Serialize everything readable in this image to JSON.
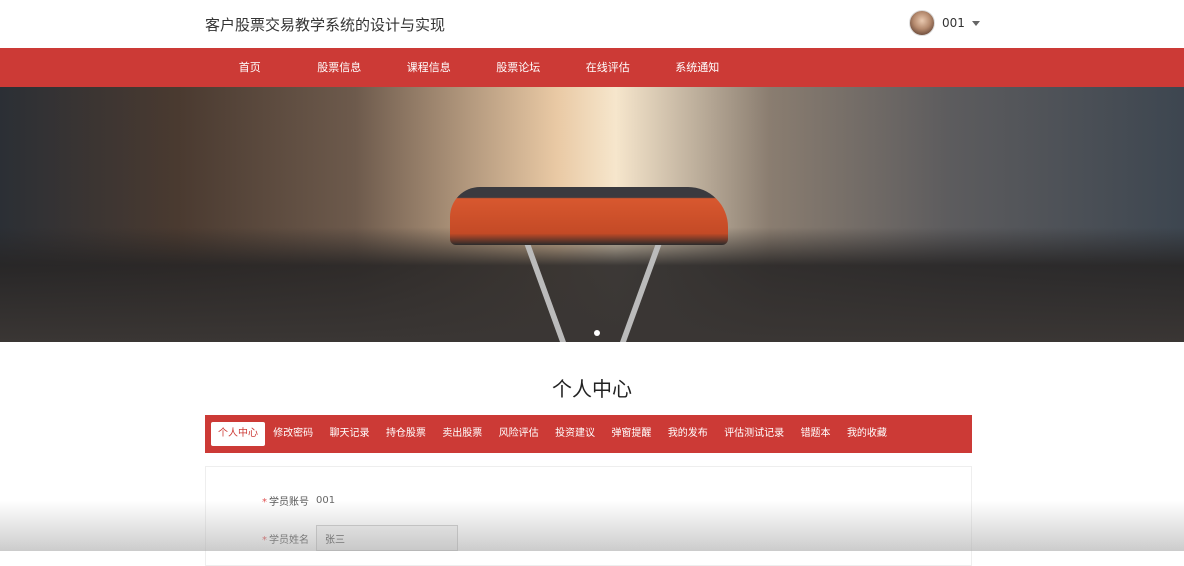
{
  "header": {
    "title": "客户股票交易教学系统的设计与实现",
    "username": "001"
  },
  "nav": [
    "首页",
    "股票信息",
    "课程信息",
    "股票论坛",
    "在线评估",
    "系统通知"
  ],
  "page_title": "个人中心",
  "tabs": [
    "个人中心",
    "修改密码",
    "聊天记录",
    "持仓股票",
    "卖出股票",
    "风险评估",
    "投资建议",
    "弹窗提醒",
    "我的发布",
    "评估测试记录",
    "错题本",
    "我的收藏"
  ],
  "form": {
    "account_label": "学员账号",
    "account_value": "001",
    "name_label": "学员姓名",
    "name_value": "张三",
    "required_mark": "*"
  },
  "colors": {
    "primary": "#cc3a36"
  }
}
